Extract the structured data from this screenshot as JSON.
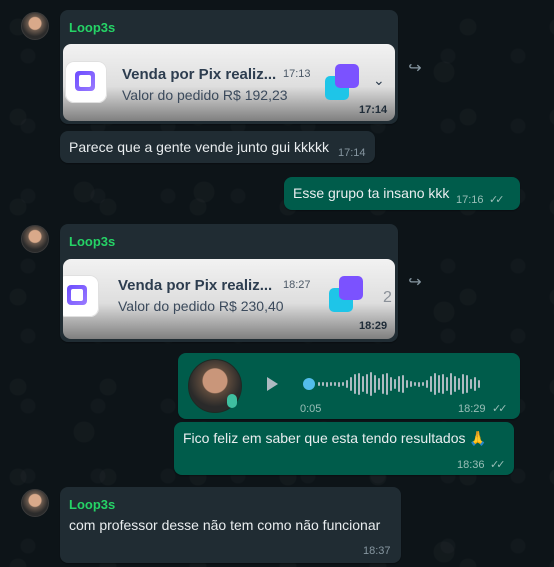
{
  "messages": [
    {
      "sender": "Loop3s"
    },
    {
      "card_title": "Venda por Pix realiz...",
      "card_time": "17:13",
      "card_subtitle": "Valor do pedido R$ 192,23",
      "time": "17:14"
    },
    {
      "text": "Parece que a gente vende junto gui kkkkk",
      "time": "17:14"
    },
    {
      "text": "Esse grupo ta insano kkk",
      "time": "17:16"
    },
    {
      "sender": "Loop3s"
    },
    {
      "card_title": "Venda por Pix realiz...",
      "card_time": "18:27",
      "card_subtitle": "Valor do pedido R$ 230,40",
      "time": "18:29",
      "overflow_count": "2"
    },
    {
      "voice_duration": "0:05",
      "time": "18:29"
    },
    {
      "text": "Fico feliz em saber que esta tendo resultados 🙏",
      "time": "18:36"
    },
    {
      "sender": "Loop3s",
      "text": "com professor desse não tem como não funcionar",
      "time": "18:37"
    }
  ],
  "icons": [
    "forward-icon",
    "chevron-down-icon",
    "play-icon",
    "mic-icon",
    "double-check-icon"
  ],
  "colors": {
    "incoming": "#202c33",
    "outgoing": "#005c4b",
    "sender": "#25d366",
    "accent": "#53bdeb"
  }
}
